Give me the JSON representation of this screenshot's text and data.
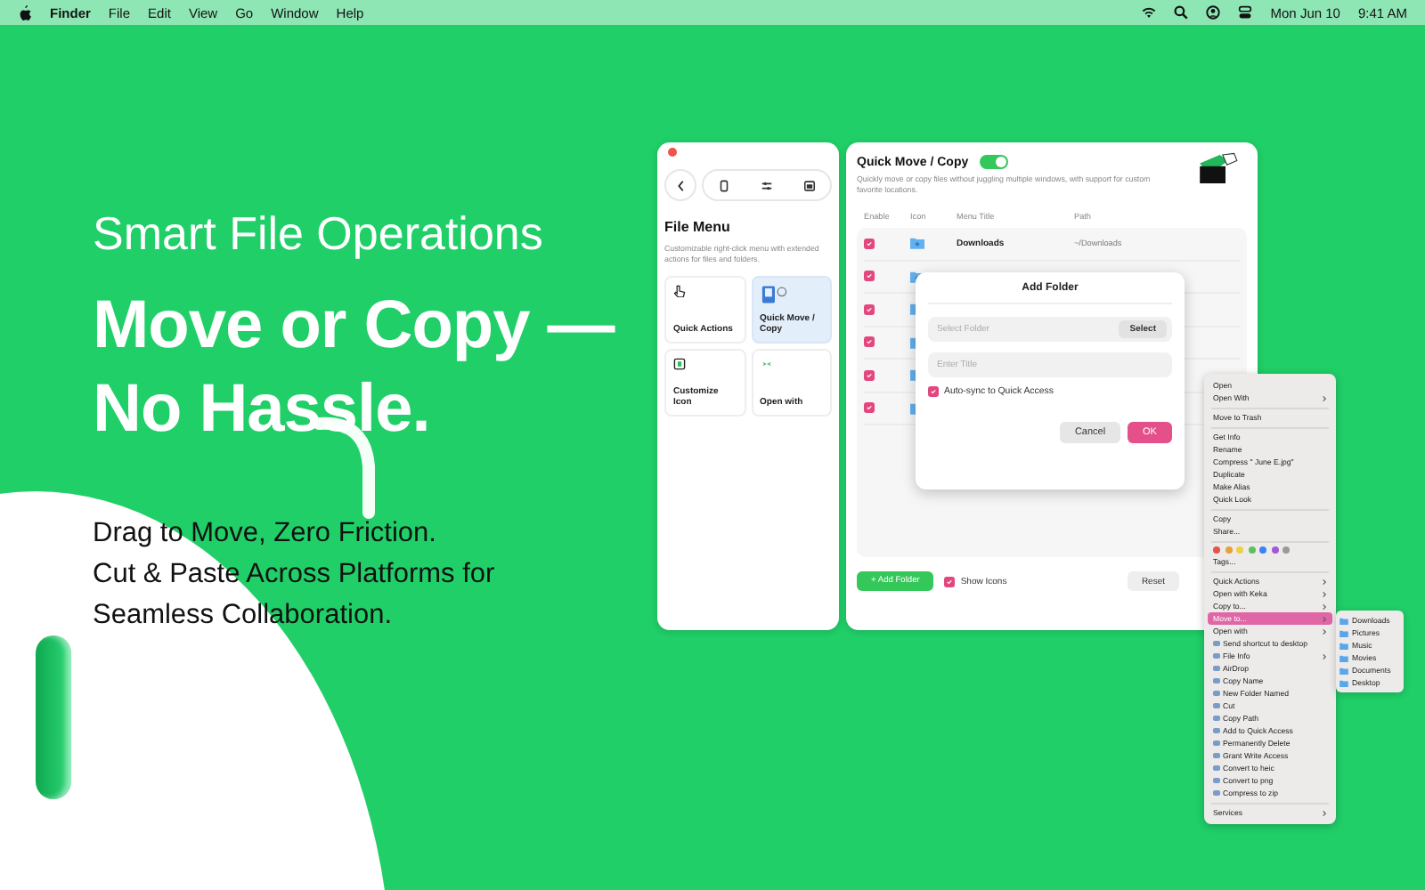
{
  "menubar": {
    "items": [
      {
        "label": "Finder",
        "bold": true
      },
      {
        "label": "File",
        "bold": false
      },
      {
        "label": "Edit",
        "bold": false
      },
      {
        "label": "View",
        "bold": false
      },
      {
        "label": "Go",
        "bold": false
      },
      {
        "label": "Window",
        "bold": false
      },
      {
        "label": "Help",
        "bold": false
      }
    ],
    "date": "Mon Jun 10",
    "time": "9:41 AM"
  },
  "hero": {
    "subtitle": "Smart File Operations",
    "title_lines": [
      "Move or Copy —",
      "No Hassle."
    ],
    "body_lines": [
      "Drag to Move, Zero Friction.",
      "Cut & Paste Across Platforms for",
      "Seamless Collaboration."
    ]
  },
  "sidebar_window": {
    "heading": "File Menu",
    "description": "Customizable right-click menu with extended actions for files and folders.",
    "cards": [
      {
        "label": "Quick Actions",
        "selected": false
      },
      {
        "label": "Quick Move / Copy",
        "selected": true
      },
      {
        "label": "Customize Icon",
        "selected": false
      },
      {
        "label": "Open with",
        "selected": false
      }
    ]
  },
  "main_window": {
    "title": "Quick Move / Copy",
    "toggle_on": true,
    "description": "Quickly move or copy files without juggling multiple windows, with support for custom favorite locations.",
    "columns": [
      "Enable",
      "Icon",
      "Menu Title",
      "Path"
    ],
    "rows": [
      {
        "enabled": true,
        "title": "Downloads",
        "path": "~/Downloads"
      },
      {
        "enabled": true
      },
      {
        "enabled": true
      },
      {
        "enabled": true
      },
      {
        "enabled": true
      },
      {
        "enabled": true
      }
    ],
    "add_button": "+ Add Folder",
    "show_icons": {
      "label": "Show Icons",
      "checked": true
    },
    "reset_button": "Reset"
  },
  "dialog": {
    "title": "Add Folder",
    "folder_placeholder": "Select Folder",
    "select_button": "Select",
    "title_placeholder": "Enter Title",
    "auto_sync": {
      "label": "Auto-sync to Quick Access",
      "checked": true
    },
    "cancel_button": "Cancel",
    "ok_button": "OK"
  },
  "context_menu": {
    "items": [
      {
        "kind": "item",
        "label": "Open",
        "submenu": false,
        "selected": false
      },
      {
        "kind": "item",
        "label": "Open With",
        "submenu": true,
        "selected": false
      },
      {
        "kind": "separator"
      },
      {
        "kind": "item",
        "label": "Move to Trash",
        "submenu": false,
        "selected": false
      },
      {
        "kind": "separator"
      },
      {
        "kind": "item",
        "label": "Get Info",
        "submenu": false,
        "selected": false
      },
      {
        "kind": "item",
        "label": "Rename",
        "submenu": false,
        "selected": false
      },
      {
        "kind": "item",
        "label": "Compress \" June E.jpg\"",
        "submenu": false,
        "selected": false
      },
      {
        "kind": "item",
        "label": "Duplicate",
        "submenu": false,
        "selected": false
      },
      {
        "kind": "item",
        "label": "Make Alias",
        "submenu": false,
        "selected": false
      },
      {
        "kind": "item",
        "label": "Quick Look",
        "submenu": false,
        "selected": false
      },
      {
        "kind": "separator"
      },
      {
        "kind": "item",
        "label": "Copy",
        "submenu": false,
        "selected": false
      },
      {
        "kind": "item",
        "label": "Share...",
        "submenu": false,
        "selected": false
      },
      {
        "kind": "separator"
      },
      {
        "kind": "tags",
        "tags": [
          {
            "color": "#e5534b"
          },
          {
            "color": "#e8a03c"
          },
          {
            "color": "#ecd04a"
          },
          {
            "color": "#5cc25c"
          },
          {
            "color": "#3b82f6"
          },
          {
            "color": "#a259d9"
          },
          {
            "color": "#9a9a9a"
          }
        ]
      },
      {
        "kind": "item",
        "label": "Tags...",
        "submenu": false,
        "selected": false
      },
      {
        "kind": "separator"
      },
      {
        "kind": "item",
        "label": "Quick Actions",
        "submenu": true,
        "selected": false
      },
      {
        "kind": "item",
        "label": "Open with Keka",
        "submenu": true,
        "selected": false
      },
      {
        "kind": "item",
        "label": "Copy to...",
        "submenu": true,
        "selected": false
      },
      {
        "kind": "item",
        "label": "Move to...",
        "submenu": true,
        "selected": true
      },
      {
        "kind": "item",
        "label": "Open with",
        "submenu": true,
        "selected": false
      },
      {
        "kind": "icon_item",
        "label": "Send shortcut to desktop",
        "submenu": false,
        "selected": false
      },
      {
        "kind": "icon_item",
        "label": "File Info",
        "submenu": true,
        "selected": false
      },
      {
        "kind": "icon_item",
        "label": "AirDrop",
        "submenu": false,
        "selected": false
      },
      {
        "kind": "icon_item",
        "label": "Copy Name",
        "submenu": false,
        "selected": false
      },
      {
        "kind": "icon_item",
        "label": "New Folder Named",
        "submenu": false,
        "selected": false
      },
      {
        "kind": "icon_item",
        "label": "Cut",
        "submenu": false,
        "selected": false
      },
      {
        "kind": "icon_item",
        "label": "Copy Path",
        "submenu": false,
        "selected": false
      },
      {
        "kind": "icon_item",
        "label": "Add to Quick Access",
        "submenu": false,
        "selected": false
      },
      {
        "kind": "icon_item",
        "label": "Permanently Delete",
        "submenu": false,
        "selected": false
      },
      {
        "kind": "icon_item",
        "label": "Grant Write Access",
        "submenu": false,
        "selected": false
      },
      {
        "kind": "icon_item",
        "label": "Convert to heic",
        "submenu": false,
        "selected": false
      },
      {
        "kind": "icon_item",
        "label": "Convert to png",
        "submenu": false,
        "selected": false
      },
      {
        "kind": "icon_item",
        "label": "Compress to zip",
        "submenu": false,
        "selected": false
      },
      {
        "kind": "separator"
      },
      {
        "kind": "item",
        "label": "Services",
        "submenu": true,
        "selected": false
      }
    ]
  },
  "submenu": {
    "items": [
      "Downloads",
      "Pictures",
      "Music",
      "Movies",
      "Documents",
      "Desktop"
    ]
  }
}
